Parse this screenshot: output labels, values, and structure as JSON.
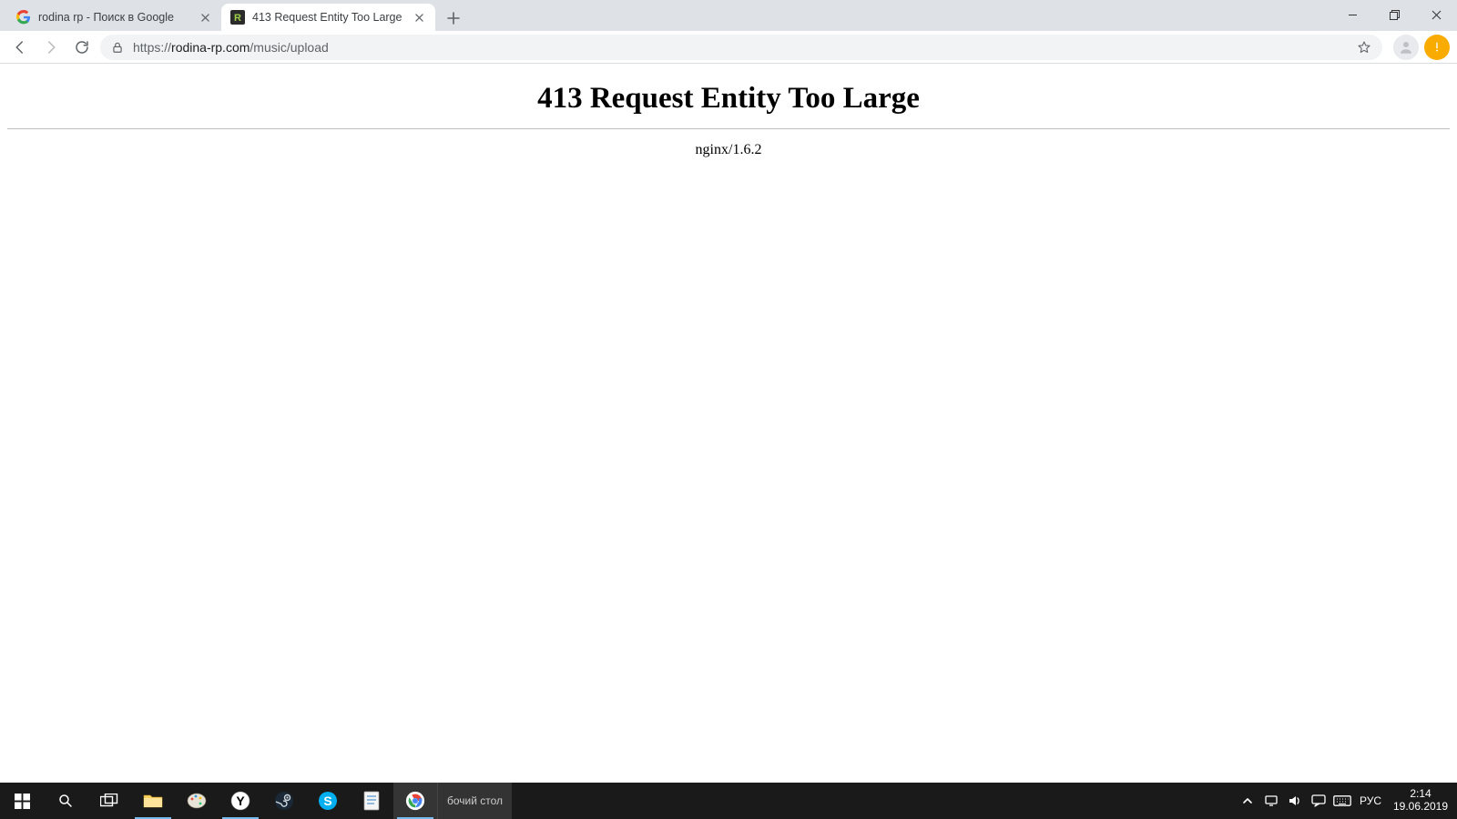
{
  "browser": {
    "tabs": [
      {
        "title": "rodina rp - Поиск в Google",
        "active": false,
        "favicon": "google"
      },
      {
        "title": "413 Request Entity Too Large",
        "active": true,
        "favicon": "site"
      }
    ],
    "address": {
      "scheme": "https://",
      "host": "rodina-rp.com",
      "path": "/music/upload"
    }
  },
  "page": {
    "heading": "413 Request Entity Too Large",
    "server": "nginx/1.6.2"
  },
  "taskbar": {
    "desktop_label": "бочий стол",
    "lang": "РУС",
    "clock": {
      "time": "2:14",
      "date": "19.06.2019"
    }
  }
}
